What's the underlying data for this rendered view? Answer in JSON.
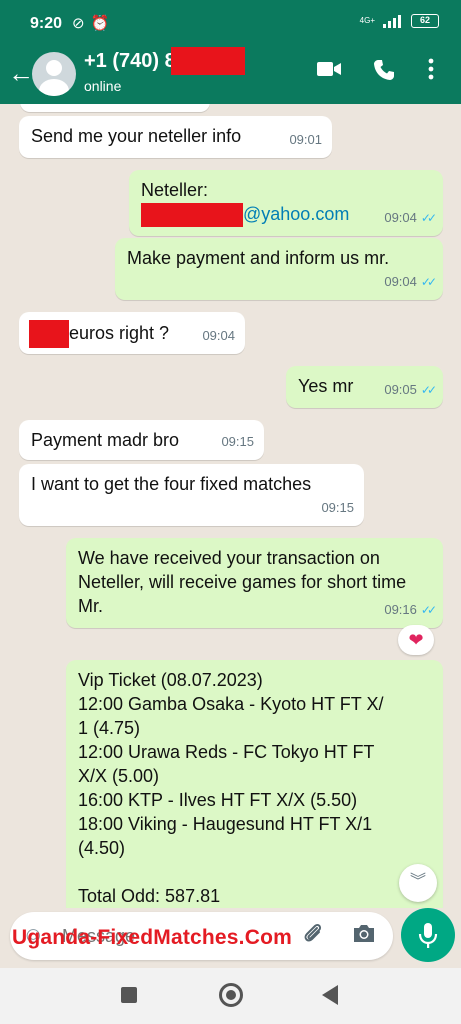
{
  "status_bar": {
    "time": "9:20",
    "network": "4G+",
    "battery": "62"
  },
  "header": {
    "contact_name": "+1 (740) 8        55",
    "contact_status": "online"
  },
  "messages": [
    {
      "id": 1,
      "text": "Send me your neteller info",
      "time": "09:01",
      "direction": "in"
    },
    {
      "id": 2,
      "line1": "Neteller:",
      "email_suffix": "@yahoo.com",
      "time": "09:04",
      "direction": "out",
      "read": true
    },
    {
      "id": 3,
      "text": "Make payment and inform us mr.",
      "time": "09:04",
      "direction": "out",
      "read": true
    },
    {
      "id": 4,
      "text": "euros right ?",
      "time": "09:04",
      "direction": "in"
    },
    {
      "id": 5,
      "text": "Yes mr",
      "time": "09:05",
      "direction": "out",
      "read": true
    },
    {
      "id": 6,
      "text": "Payment madr bro",
      "time": "09:15",
      "direction": "in"
    },
    {
      "id": 7,
      "text": "I want to get the four fixed matches",
      "time": "09:15",
      "direction": "in"
    },
    {
      "id": 8,
      "text": "We have received your transaction on Neteller, will receive games for short time Mr.",
      "time": "09:16",
      "direction": "out",
      "read": true,
      "reaction": "heart"
    },
    {
      "id": 9,
      "direction": "out",
      "lines": [
        "Vip Ticket (08.07.2023)",
        "12:00 Gamba Osaka - Kyoto HT FT X/",
        "1 (4.75)",
        "12:00 Urawa Reds - FC Tokyo HT FT",
        "X/X (5.00)",
        "16:00 KTP - Ilves HT FT X/X (5.50)",
        "18:00 Viking - Haugesund HT FT X/1",
        "(4.50)",
        "",
        "Total Odd: 587.81"
      ]
    }
  ],
  "input": {
    "placeholder": "Message",
    "watermark": "Uganda-FixedMatches.Com"
  },
  "colors": {
    "header": "#0b7a5e",
    "outgoing_bubble": "#dcf8c6",
    "incoming_bubble": "#ffffff",
    "mic_button": "#00a884",
    "read_tick": "#34b7f1"
  }
}
